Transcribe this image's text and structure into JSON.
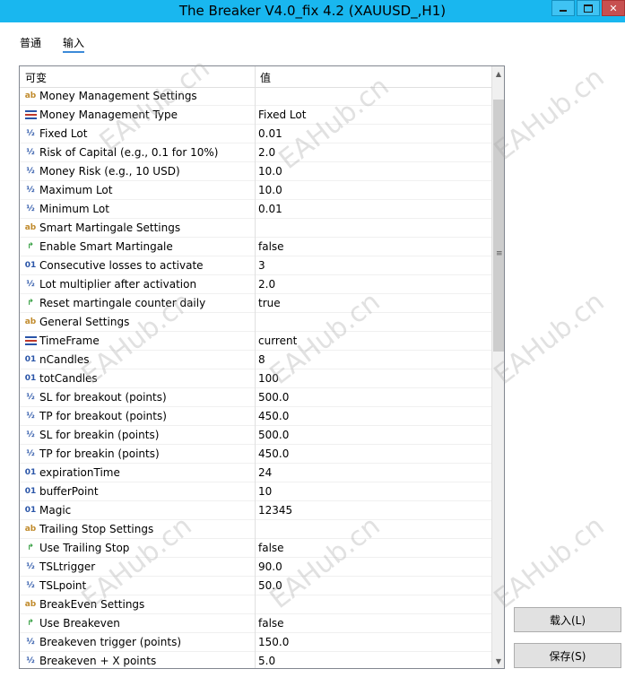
{
  "window": {
    "title": "The Breaker V4.0_fix 4.2 (XAUUSD_,H1)"
  },
  "tabs": [
    {
      "label": "普通"
    },
    {
      "label": "输入"
    }
  ],
  "grid": {
    "col_variable": "可变",
    "col_value": "值",
    "rows": [
      {
        "icon": "ab",
        "name": "Money Management Settings",
        "value": ""
      },
      {
        "icon": "enum",
        "name": "Money Management Type",
        "value": "Fixed Lot"
      },
      {
        "icon": "½",
        "name": "Fixed Lot",
        "value": "0.01"
      },
      {
        "icon": "½",
        "name": "Risk of Capital (e.g., 0.1 for 10%)",
        "value": "2.0"
      },
      {
        "icon": "½",
        "name": "Money Risk (e.g., 10 USD)",
        "value": "10.0"
      },
      {
        "icon": "½",
        "name": "Maximum Lot",
        "value": "10.0"
      },
      {
        "icon": "½",
        "name": "Minimum Lot",
        "value": "0.01"
      },
      {
        "icon": "ab",
        "name": "Smart Martingale Settings",
        "value": ""
      },
      {
        "icon": "bool",
        "name": "Enable Smart Martingale",
        "value": "false"
      },
      {
        "icon": "01",
        "name": "Consecutive losses to activate",
        "value": "3"
      },
      {
        "icon": "½",
        "name": "Lot multiplier after activation",
        "value": "2.0"
      },
      {
        "icon": "bool",
        "name": "Reset martingale counter daily",
        "value": "true"
      },
      {
        "icon": "ab",
        "name": "General Settings",
        "value": ""
      },
      {
        "icon": "enum",
        "name": "TimeFrame",
        "value": "current"
      },
      {
        "icon": "01",
        "name": "nCandles",
        "value": "8"
      },
      {
        "icon": "01",
        "name": "totCandles",
        "value": "100"
      },
      {
        "icon": "½",
        "name": "SL for breakout (points)",
        "value": "500.0"
      },
      {
        "icon": "½",
        "name": "TP for breakout (points)",
        "value": "450.0"
      },
      {
        "icon": "½",
        "name": "SL for breakin (points)",
        "value": "500.0"
      },
      {
        "icon": "½",
        "name": "TP for breakin (points)",
        "value": "450.0"
      },
      {
        "icon": "01",
        "name": "expirationTime",
        "value": "24"
      },
      {
        "icon": "01",
        "name": "bufferPoint",
        "value": "10"
      },
      {
        "icon": "01",
        "name": "Magic",
        "value": "12345"
      },
      {
        "icon": "ab",
        "name": "Trailing Stop Settings",
        "value": ""
      },
      {
        "icon": "bool",
        "name": "Use Trailing Stop",
        "value": "false"
      },
      {
        "icon": "½",
        "name": "TSLtrigger",
        "value": "90.0"
      },
      {
        "icon": "½",
        "name": "TSLpoint",
        "value": "50.0"
      },
      {
        "icon": "ab",
        "name": "BreakEven Settings",
        "value": ""
      },
      {
        "icon": "bool",
        "name": "Use Breakeven",
        "value": "false"
      },
      {
        "icon": "½",
        "name": "Breakeven trigger (points)",
        "value": "150.0"
      },
      {
        "icon": "½",
        "name": "Breakeven + X points",
        "value": "5.0"
      }
    ]
  },
  "buttons": {
    "load": "载入(L)",
    "save": "保存(S)"
  },
  "watermark": "EAHub.cn"
}
